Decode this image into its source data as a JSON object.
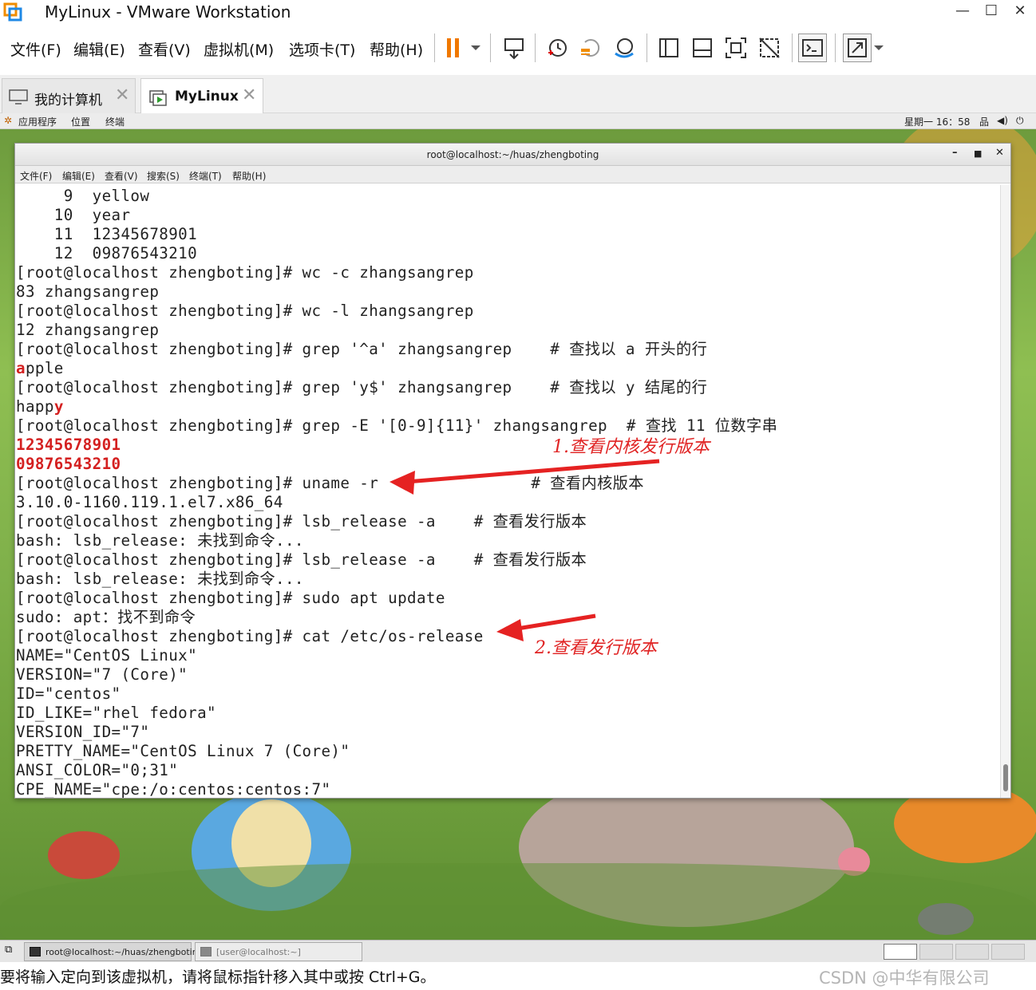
{
  "window": {
    "title": "MyLinux - VMware Workstation",
    "minimize": "—",
    "maximize": "☐",
    "close": "✕"
  },
  "menu": {
    "file": "文件(F)",
    "edit": "编辑(E)",
    "view": "查看(V)",
    "vm": "虚拟机(M)",
    "tabs": "选项卡(T)",
    "help": "帮助(H)"
  },
  "tabs": [
    {
      "label": "我的计算机"
    },
    {
      "label": "MyLinux"
    }
  ],
  "guest_panel": {
    "applications": "应用程序",
    "places": "位置",
    "terminal": "终端",
    "clock": "星期一 16：58"
  },
  "terminal": {
    "title": "root@localhost:~/huas/zhengboting",
    "menu": [
      "文件(F)",
      "编辑(E)",
      "查看(V)",
      "搜索(S)",
      "终端(T)",
      "帮助(H)"
    ],
    "lines": [
      "     9  yellow",
      "    10  year",
      "    11  12345678901",
      "    12  09876543210",
      "[root@localhost zhengboting]# wc -c zhangsangrep",
      "83 zhangsangrep",
      "[root@localhost zhengboting]# wc -l zhangsangrep",
      "12 zhangsangrep",
      "[root@localhost zhengboting]# grep '^a' zhangsangrep    # 查找以 a 开头的行",
      "apple",
      "[root@localhost zhengboting]# grep 'y$' zhangsangrep    # 查找以 y 结尾的行",
      "happy",
      "[root@localhost zhengboting]# grep -E '[0-9]{11}' zhangsangrep  # 查找 11 位数字串",
      "12345678901",
      "09876543210",
      "[root@localhost zhengboting]# uname -r                # 查看内核版本",
      "3.10.0-1160.119.1.el7.x86_64",
      "[root@localhost zhengboting]# lsb_release -a    # 查看发行版本",
      "bash: lsb_release: 未找到命令...",
      "[root@localhost zhengboting]# lsb_release -a    # 查看发行版本",
      "bash: lsb_release: 未找到命令...",
      "[root@localhost zhengboting]# sudo apt update",
      "sudo: apt：找不到命令",
      "[root@localhost zhengboting]# cat /etc/os-release",
      "NAME=\"CentOS Linux\"",
      "VERSION=\"7 (Core)\"",
      "ID=\"centos\"",
      "ID_LIKE=\"rhel fedora\"",
      "VERSION_ID=\"7\"",
      "PRETTY_NAME=\"CentOS Linux 7 (Core)\"",
      "ANSI_COLOR=\"0;31\"",
      "CPE_NAME=\"cpe:/o:centos:centos:7\""
    ],
    "highlights": {
      "apple_hl": "a",
      "apple_rest": "pple",
      "happy_pre": "happ",
      "happy_hl": "y"
    }
  },
  "annotations": {
    "kernel": "1.查看内核发行版本",
    "release": "2.查看发行版本"
  },
  "taskbar": {
    "task1": "root@localhost:~/huas/zhengboting",
    "task2": "[user@localhost:~]"
  },
  "status": {
    "message": "要将输入定向到该虚拟机，请将鼠标指针移入其中或按 Ctrl+G。",
    "watermark": "CSDN @中华有限公司"
  },
  "colors": {
    "highlight": "#d42020",
    "annotation": "#e02424",
    "pause_icon": "#f07800"
  }
}
